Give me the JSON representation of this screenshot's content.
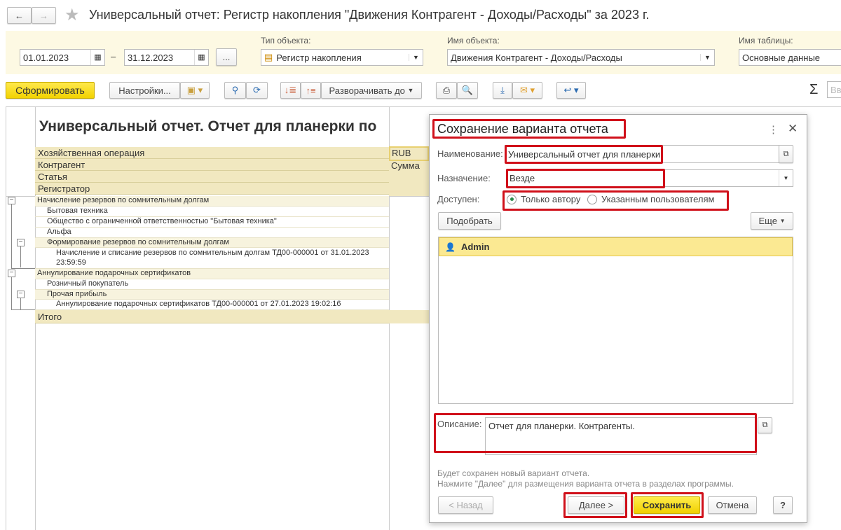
{
  "window": {
    "title": "Универсальный отчет: Регистр накопления \"Движения Контрагент - Доходы/Расходы\" за 2023 г."
  },
  "params": {
    "date_from": "01.01.2023",
    "date_sep": "–",
    "date_to": "31.12.2023",
    "dots": "...",
    "object_type_label": "Тип объекта:",
    "object_type": "Регистр накопления",
    "object_name_label": "Имя объекта:",
    "object_name": "Движения Контрагент - Доходы/Расходы",
    "table_name_label": "Имя таблицы:",
    "table_name": "Основные данные"
  },
  "toolbar": {
    "generate": "Сформировать",
    "settings": "Настройки...",
    "expand": "Разворачивать до",
    "sum": "Σ",
    "search_placeholder": "Вв"
  },
  "report": {
    "title": "Универсальный отчет. Отчет для планерки по",
    "headers": [
      "Хозяйственная операция",
      "Контрагент",
      "Статья",
      "Регистратор"
    ],
    "currency": "RUB",
    "sum": "Сумма",
    "rows": [
      "Начисление резервов по сомнительным долгам",
      "Бытовая техника",
      "Общество с ограниченной ответственностью \"Бытовая техника\"",
      "Альфа",
      "Формирование резервов по сомнительным долгам",
      "Начисление и списание резервов по сомнительным долгам ТД00-000001 от 31.01.2023",
      "23:59:59",
      "Аннулирование подарочных сертификатов",
      "Розничный покупатель",
      "Прочая прибыль",
      "Аннулирование подарочных сертификатов ТД00-000001 от 27.01.2023 19:02:16"
    ],
    "total": "Итого"
  },
  "dialog": {
    "title": "Сохранение варианта отчета",
    "name_label": "Наименование:",
    "name_value": "Универсальный отчет для планерки",
    "purpose_label": "Назначение:",
    "purpose_value": "Везде",
    "available_label": "Доступен:",
    "radio_author": "Только автору",
    "radio_users": "Указанным пользователям",
    "radio_selected": "Только автору",
    "pick": "Подобрать",
    "more": "Еще",
    "users": [
      "Admin"
    ],
    "desc_label": "Описание:",
    "desc_value": "Отчет для планерки. Контрагенты.",
    "info1": "Будет сохранен новый вариант отчета.",
    "info2": "Нажмите \"Далее\" для размещения варианта отчета в разделах программы.",
    "back": "< Назад",
    "next": "Далее >",
    "save": "Сохранить",
    "cancel": "Отмена",
    "help": "?"
  },
  "colors": {
    "accent_yellow": "#f5d800",
    "highlight": "#d0101a",
    "panel": "#fdf9e3"
  }
}
